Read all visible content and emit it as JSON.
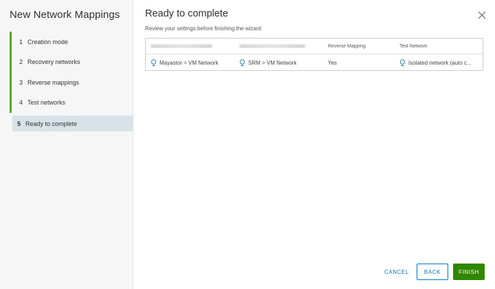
{
  "wizard": {
    "title": "New Network Mappings",
    "steps": [
      {
        "num": "1",
        "label": "Creation mode"
      },
      {
        "num": "2",
        "label": "Recovery networks"
      },
      {
        "num": "3",
        "label": "Reverse mappings"
      },
      {
        "num": "4",
        "label": "Test networks"
      },
      {
        "num": "5",
        "label": "Ready to complete"
      }
    ],
    "active_step": 5
  },
  "page": {
    "title": "Ready to complete",
    "subtitle": "Review your settings before finishing the wizard"
  },
  "table": {
    "headers": [
      "",
      "",
      "Reverse Mapping",
      "Test Network"
    ],
    "rows": [
      {
        "source": "Mayastor > VM Network",
        "target": "SRM > VM Network",
        "reverse_mapping": "Yes",
        "test_network": "Isolated network (auto c..."
      }
    ]
  },
  "buttons": {
    "cancel": "CANCEL",
    "back": "BACK",
    "finish": "FINISH"
  },
  "colors": {
    "accent_green": "#5aa220",
    "primary_blue": "#0079b8",
    "finish_green": "#318700",
    "active_step_bg": "#d8e3e9"
  }
}
